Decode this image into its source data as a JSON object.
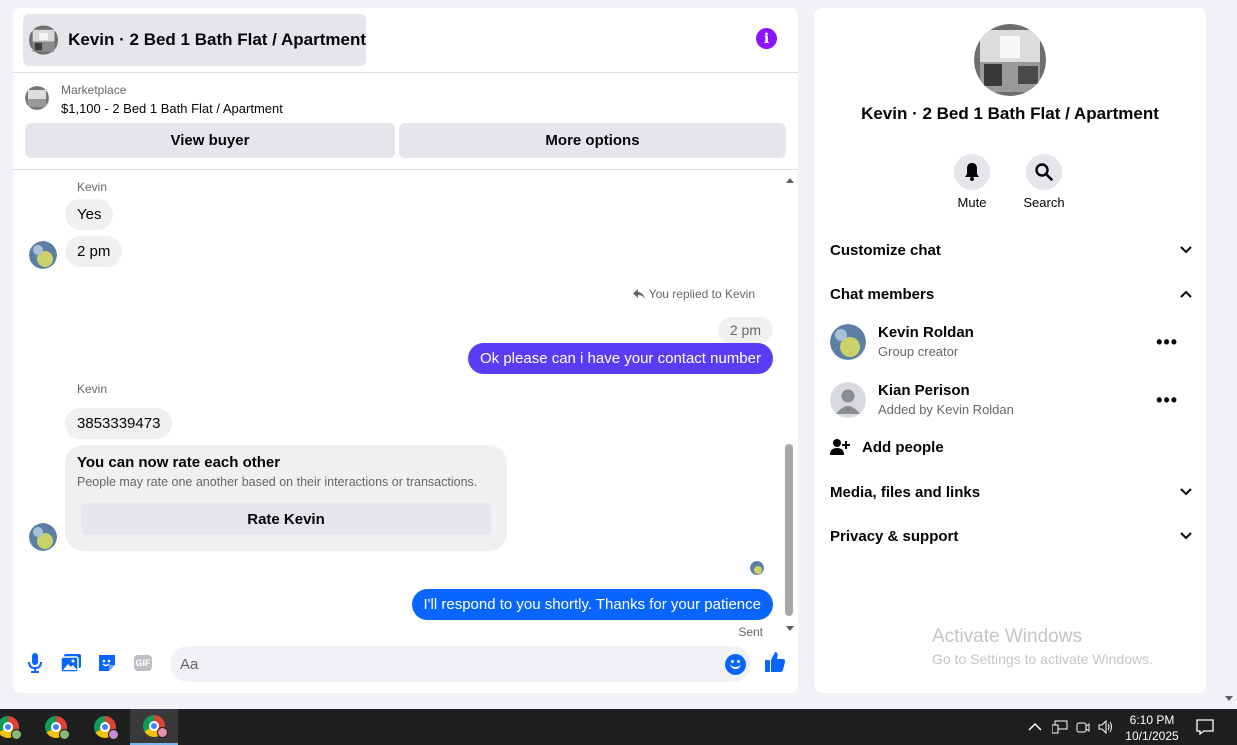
{
  "chat": {
    "header_title": "Kevin · 2 Bed 1 Bath Flat / Apartment",
    "marketplace_label": "Marketplace",
    "listing": "$1,100 - 2 Bed 1 Bath Flat / Apartment",
    "view_buyer_label": "View buyer",
    "more_options_label": "More options",
    "messages": {
      "sender_1": "Kevin",
      "in_1": "Yes",
      "in_2": "2 pm",
      "replied_note": "You replied to Kevin",
      "quoted": "2 pm",
      "out_1": "Ok please can i have your contact number",
      "sender_2": "Kevin",
      "in_3": "3853339473",
      "rate_title": "You can now rate each other",
      "rate_sub": "People may rate one another based on their interactions or transactions.",
      "rate_button": "Rate Kevin",
      "out_2": "I'll respond to you shortly. Thanks for your patience",
      "status": "Sent"
    },
    "composer_placeholder": "Aa",
    "gif_label": "GIF",
    "colors": {
      "out_bubble_1": "#5b3cf5",
      "out_bubble_2": "#0866ff",
      "accent_blue": "#0866ff",
      "info_purple": "#8a14ff"
    }
  },
  "info": {
    "title": "Kevin · 2 Bed 1 Bath Flat / Apartment",
    "mute_label": "Mute",
    "search_label": "Search",
    "customize_chat": "Customize chat",
    "chat_members": "Chat members",
    "members": [
      {
        "name": "Kevin Roldan",
        "role": "Group creator"
      },
      {
        "name": "Kian Perison",
        "role": "Added by Kevin Roldan"
      }
    ],
    "add_people": "Add people",
    "media_files_links": "Media, files and links",
    "privacy_support": "Privacy & support"
  },
  "watermark": {
    "line1": "Activate Windows",
    "line2": "Go to Settings to activate Windows."
  },
  "taskbar": {
    "time": "6:10 PM",
    "date": "10/1/2025"
  }
}
